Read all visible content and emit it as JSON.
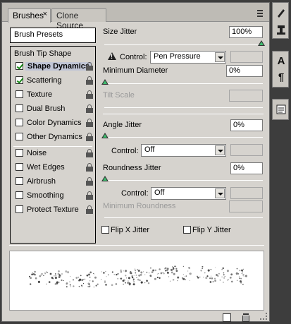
{
  "tabs": [
    {
      "label": "Brushes",
      "active": true
    },
    {
      "label": "Clone Source",
      "active": false
    }
  ],
  "close_glyph": "×",
  "left": {
    "presets_label": "Brush Presets",
    "tip_shape_label": "Brush Tip Shape",
    "options": [
      {
        "label": "Shape Dynamics",
        "checked": true,
        "selected": true
      },
      {
        "label": "Scattering",
        "checked": true
      },
      {
        "label": "Texture",
        "checked": false
      },
      {
        "label": "Dual Brush",
        "checked": false
      },
      {
        "label": "Color Dynamics",
        "checked": false
      },
      {
        "label": "Other Dynamics",
        "checked": false
      },
      {
        "label": "Noise",
        "checked": false
      },
      {
        "label": "Wet Edges",
        "checked": false
      },
      {
        "label": "Airbrush",
        "checked": false
      },
      {
        "label": "Smoothing",
        "checked": false
      },
      {
        "label": "Protect Texture",
        "checked": false
      }
    ]
  },
  "right": {
    "size_jitter": {
      "label": "Size Jitter",
      "value": "100%",
      "slider": 1.0
    },
    "size_control": {
      "label": "Control:",
      "value": "Pen Pressure"
    },
    "min_diameter": {
      "label": "Minimum Diameter",
      "value": "0%",
      "slider": 0.0
    },
    "tilt_scale": {
      "label": "Tilt Scale",
      "value": ""
    },
    "angle_jitter": {
      "label": "Angle Jitter",
      "value": "0%",
      "slider": 0.0
    },
    "angle_control": {
      "label": "Control:",
      "value": "Off"
    },
    "roundness_jitter": {
      "label": "Roundness Jitter",
      "value": "0%",
      "slider": 0.0
    },
    "roundness_control": {
      "label": "Control:",
      "value": "Off"
    },
    "min_roundness": {
      "label": "Minimum Roundness",
      "value": ""
    },
    "flip_x": {
      "label": "Flip X Jitter",
      "checked": false
    },
    "flip_y": {
      "label": "Flip Y Jitter",
      "checked": false
    }
  },
  "toolbar_icons": [
    "brush-panel-icon",
    "clone-source-icon",
    "character-icon",
    "paragraph-icon",
    "notes-icon"
  ],
  "toolbar_glyphs": {
    "char": "A",
    "para": "¶"
  },
  "colors": {
    "panel_bg": "#d6d3ce",
    "selected_row": "#c1c6d6",
    "check_green": "#1a8a1a",
    "slider_thumb": "#3fbf6f"
  }
}
